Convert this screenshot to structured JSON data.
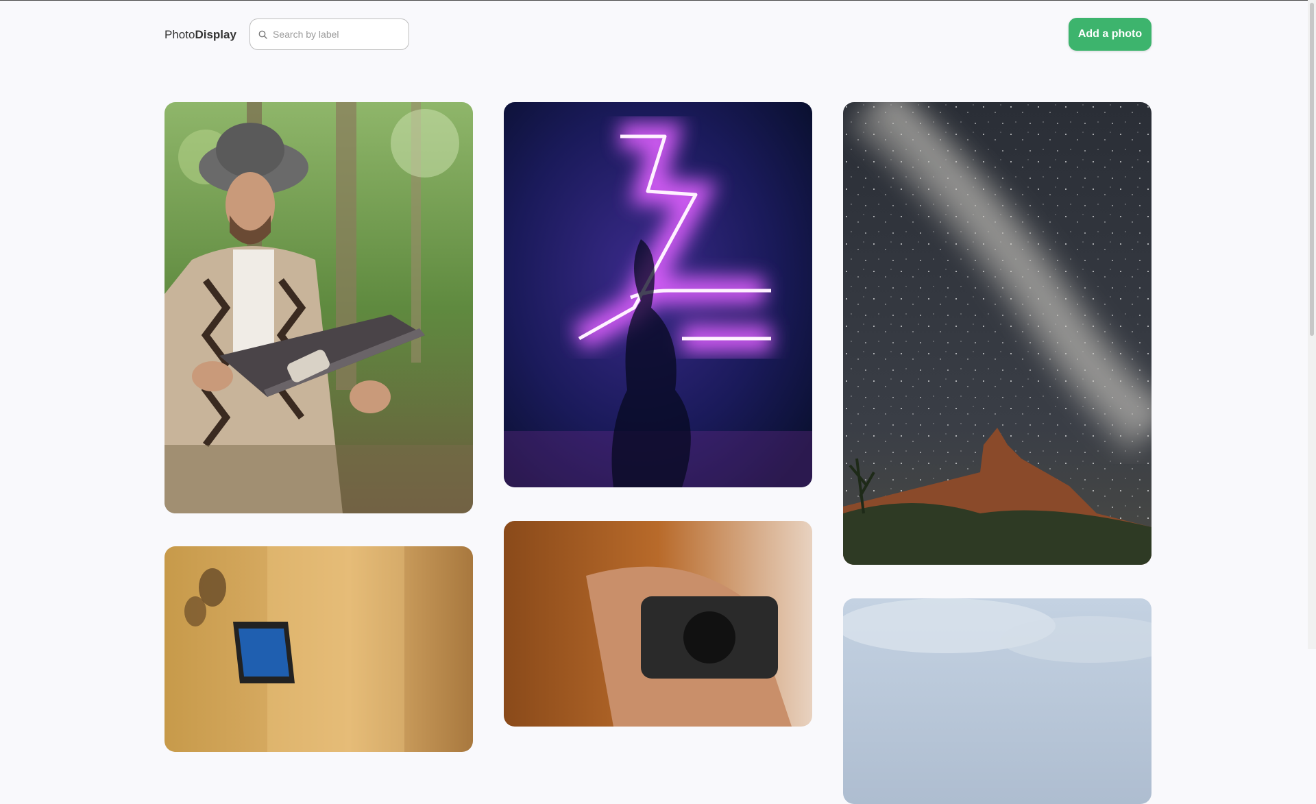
{
  "app": {
    "logo_light": "Photo",
    "logo_bold": "Display"
  },
  "search": {
    "placeholder": "Search by label",
    "value": "",
    "icon": "search-icon"
  },
  "toolbar": {
    "add_label": "Add a photo"
  },
  "colors": {
    "accent": "#3db46d",
    "background": "#f9f9fc"
  },
  "photos": [
    {
      "subject": "man-with-laptop-forest"
    },
    {
      "subject": "neon-lightning-bolt"
    },
    {
      "subject": "milky-way-over-rock"
    },
    {
      "subject": "laptop-on-wooden-desk"
    },
    {
      "subject": "hands-holding-camera"
    },
    {
      "subject": "cloudy-sky"
    }
  ]
}
